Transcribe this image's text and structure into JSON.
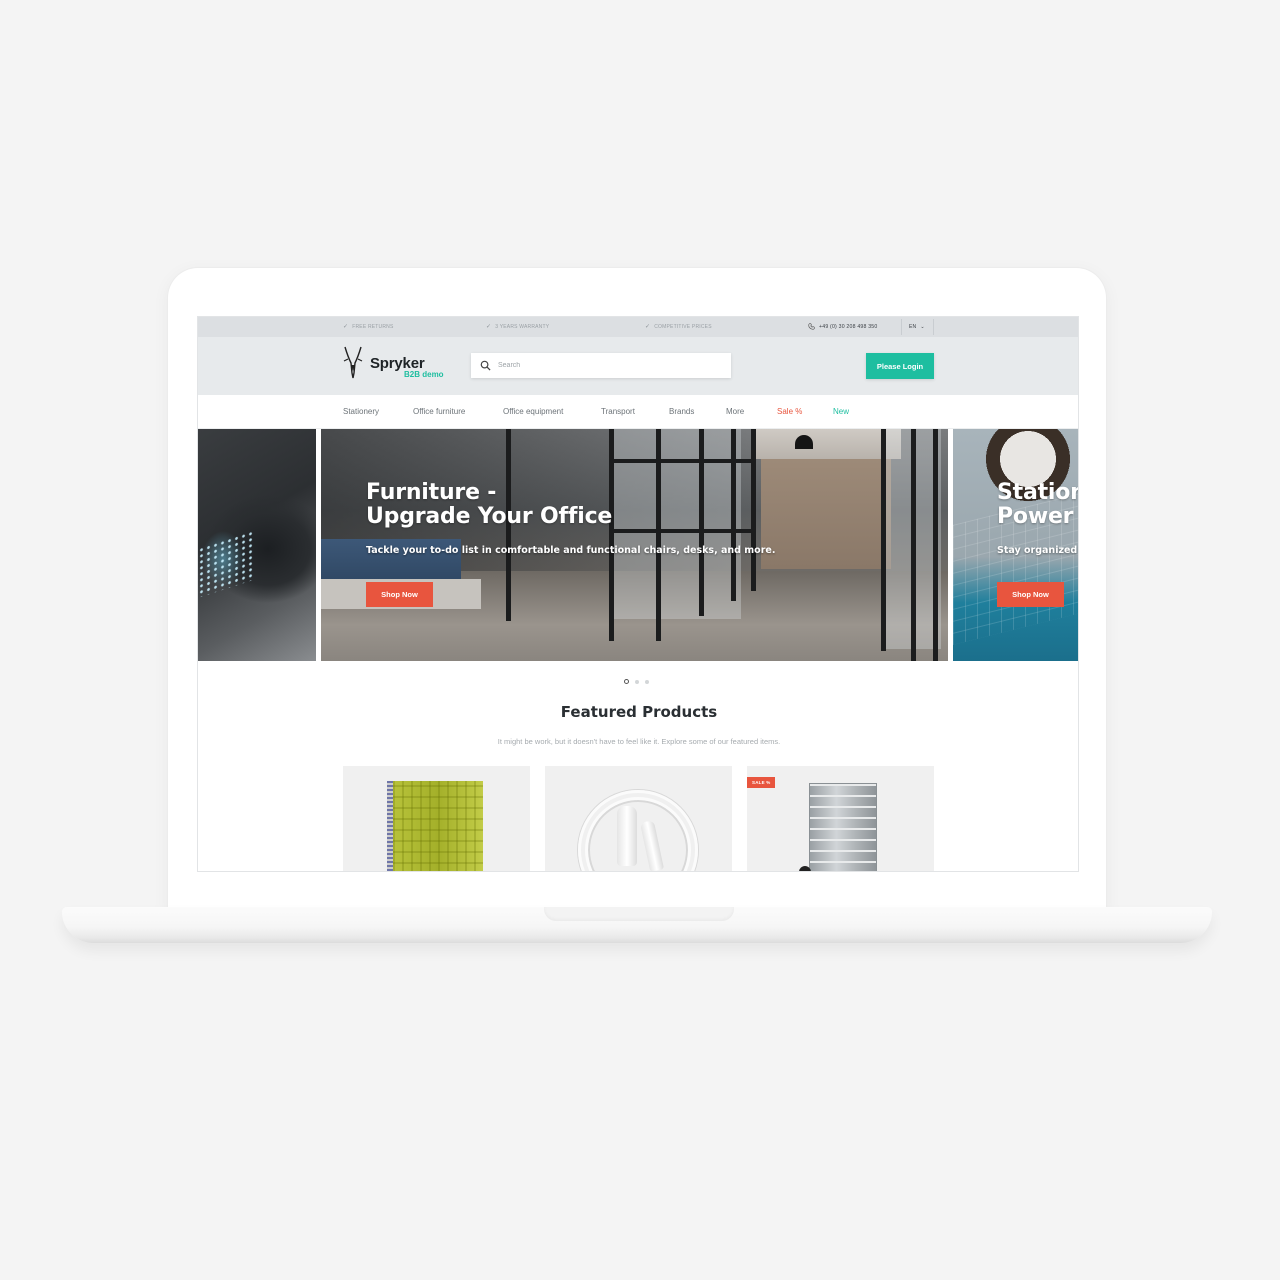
{
  "topbar": {
    "usps": [
      {
        "icon": "check-icon",
        "label": "Free Returns"
      },
      {
        "icon": "check-icon",
        "label": "3 Years Warranty"
      },
      {
        "icon": "check-icon",
        "label": "Competitive Prices"
      }
    ],
    "phone": "+49 (0) 30 208 498 350",
    "language": "EN"
  },
  "header": {
    "logo_name": "Spryker",
    "logo_sub": "B2B demo",
    "search_placeholder": "Search",
    "search_value": "",
    "login_label": "Please Login"
  },
  "nav": {
    "items": [
      {
        "label": "Stationery"
      },
      {
        "label": "Office furniture"
      },
      {
        "label": "Office equipment"
      },
      {
        "label": "Transport"
      },
      {
        "label": "Brands"
      },
      {
        "label": "More"
      },
      {
        "label": "Sale %"
      },
      {
        "label": "New"
      }
    ]
  },
  "hero": {
    "slides": [
      {
        "title_line1": "Furniture -",
        "title_line2": "Upgrade Your Office",
        "text": "Tackle your to-do list in comfortable and functional chairs, desks, and more.",
        "button": "Shop Now"
      },
      {
        "title_line1": "Station",
        "title_line2": "Power",
        "text": "Stay organized",
        "button": "Shop Now"
      }
    ],
    "active_dot": 1,
    "dot_count": 3
  },
  "featured": {
    "title": "Featured Products",
    "subtitle": "It might be work, but it doesn't have to feel like it. Explore some of our featured items.",
    "products": [
      {
        "image": "spiral-notebook",
        "badge": null
      },
      {
        "image": "extension-cable",
        "badge": null
      },
      {
        "image": "aluminum-cabinet",
        "badge": "SALE %"
      }
    ]
  },
  "colors": {
    "accent_green": "#1ebea0",
    "accent_red": "#e8553e",
    "topbar_bg": "#dcdfe2",
    "header_bg": "#e7eaec"
  }
}
